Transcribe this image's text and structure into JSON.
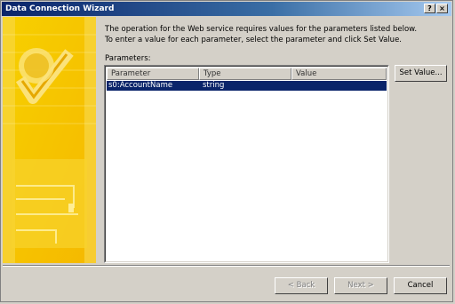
{
  "window": {
    "title": "Data Connection Wizard",
    "help_glyph": "?",
    "close_glyph": "×"
  },
  "description": {
    "line1": "The operation for the Web service requires values for the parameters listed below.",
    "line2": "To enter a value for each parameter, select the parameter and click Set Value."
  },
  "parameters": {
    "label": "Parameters:",
    "columns": [
      "Parameter",
      "Type",
      "Value"
    ],
    "rows": [
      {
        "parameter": "s0:AccountName",
        "type": "string",
        "value": ""
      }
    ],
    "set_value_label": "Set Value..."
  },
  "footer": {
    "back_label": "< Back",
    "next_label": "Next >",
    "cancel_label": "Cancel"
  },
  "colors": {
    "titlebar_start": "#0a246a",
    "sidebar_yellow": "#f5c400",
    "selection": "#0a246a"
  }
}
